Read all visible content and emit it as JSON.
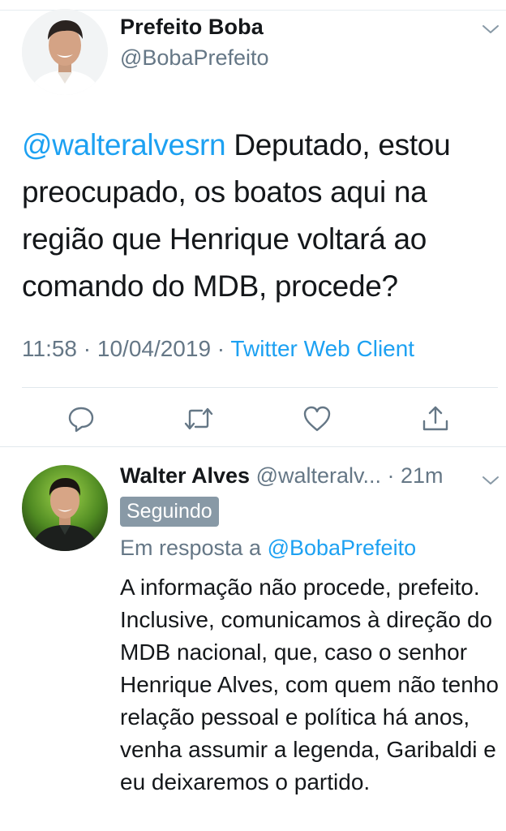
{
  "main_tweet": {
    "name": "Prefeito Boba",
    "handle": "@BobaPrefeito",
    "mention": "@walteralvesrn",
    "text": " Deputado, estou preocupado, os boatos aqui na região que Henrique voltará ao comando do MDB, procede?",
    "time": "11:58",
    "dot1": " · ",
    "date": "10/04/2019",
    "dot2": " · ",
    "client": "Twitter Web Client",
    "actions": [
      "reply-icon",
      "retweet-icon",
      "like-icon",
      "share-icon"
    ],
    "avatar_icon": "profile-photo"
  },
  "reply": {
    "name": "Walter Alves",
    "handle_and_time": " @walteralv... · 21m",
    "following_badge": "Seguindo",
    "in_reply_prefix": "Em resposta a ",
    "in_reply_handle": "@BobaPrefeito",
    "text": "A informação não procede, prefeito. Inclusive, comunicamos à direção do MDB nacional, que, caso o senhor Henrique Alves, com quem não tenho relação pessoal e política há anos, venha assumir a legenda, Garibaldi e eu deixaremos o partido.",
    "avatar_icon": "profile-photo"
  },
  "colors": {
    "link": "#1da1f2",
    "secondary_text": "#657786",
    "badge_bg": "#8899a6"
  }
}
